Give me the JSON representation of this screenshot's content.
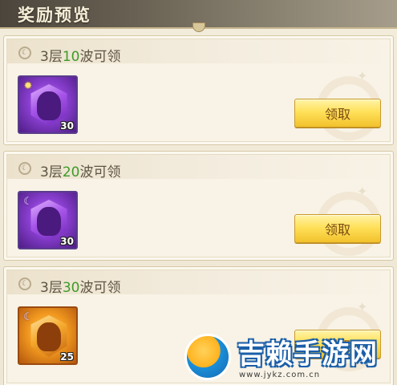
{
  "header": {
    "title": "奖励预览"
  },
  "rewards": [
    {
      "label_prefix": "3层",
      "label_num": "10",
      "label_suffix": "波可领",
      "item_rarity": "purple",
      "item_badge_icon": "sun-icon",
      "item_qty": "30",
      "claim_label": "领取"
    },
    {
      "label_prefix": "3层",
      "label_num": "20",
      "label_suffix": "波可领",
      "item_rarity": "purple",
      "item_badge_icon": "moon-icon",
      "item_qty": "30",
      "claim_label": "领取"
    },
    {
      "label_prefix": "3层",
      "label_num": "30",
      "label_suffix": "波可领",
      "item_rarity": "orange",
      "item_badge_icon": "sun-moon-icon",
      "item_qty": "25",
      "claim_label": "领取"
    }
  ],
  "watermark": {
    "text": "吉赖手游网",
    "url": "www.jykz.com.cn"
  },
  "colors": {
    "accent_green": "#3d9a2a",
    "button_gold": "#ffe15a",
    "label_text": "#5e5444"
  }
}
